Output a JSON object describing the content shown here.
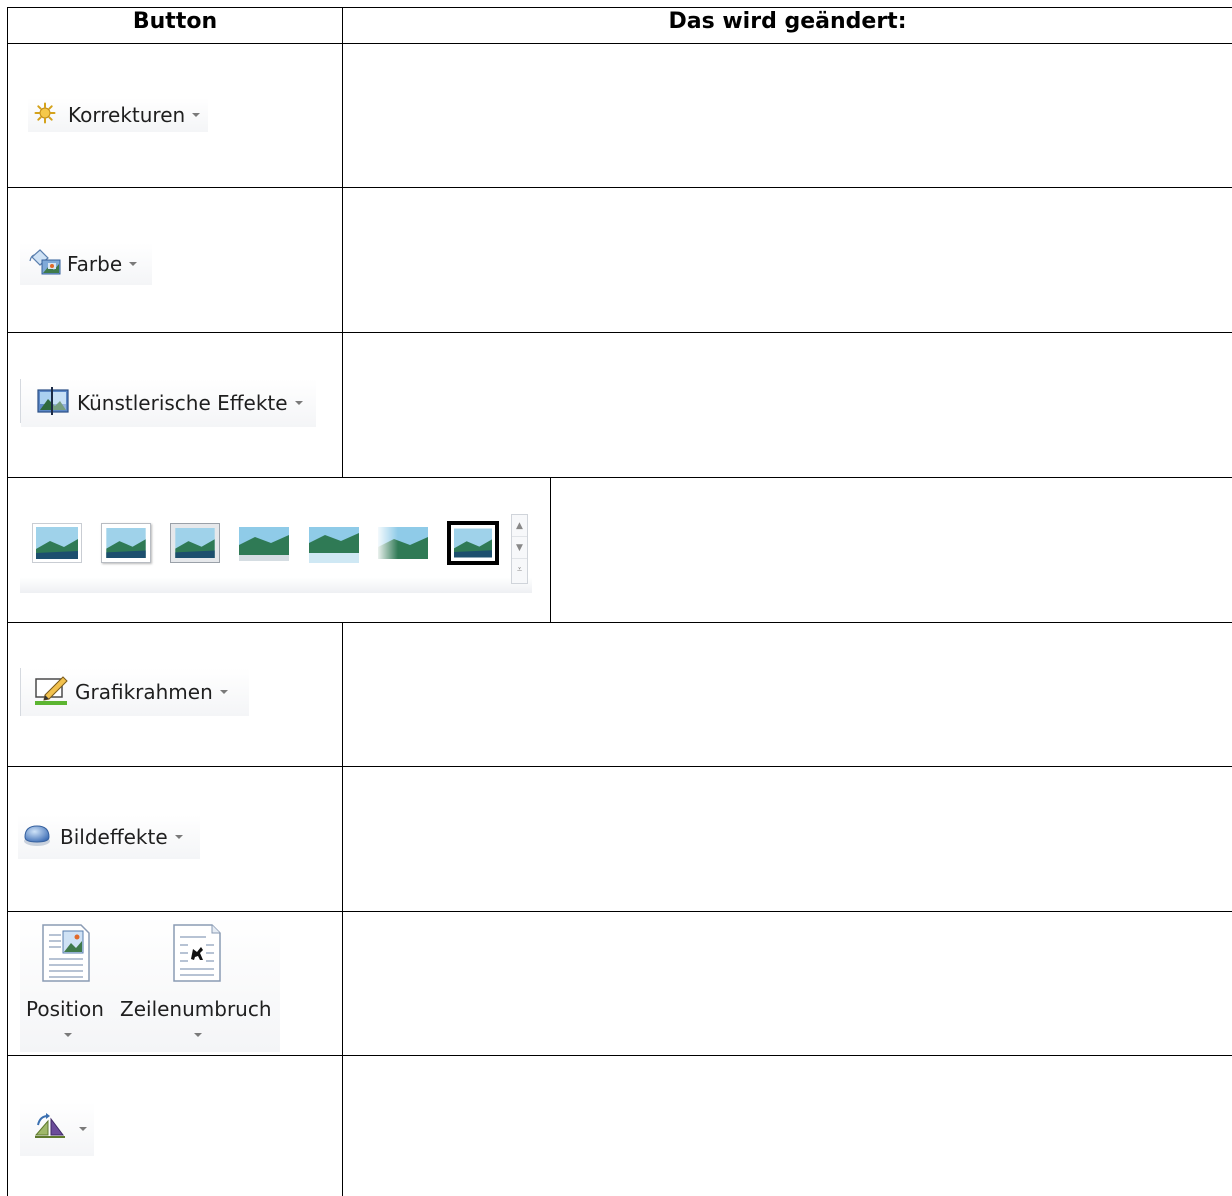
{
  "table": {
    "header_button": "Button",
    "header_changes": "Das wird geändert:"
  },
  "rows": {
    "korrekturen": {
      "label": "Korrekturen",
      "icon": "sun-brightness-icon"
    },
    "farbe": {
      "label": "Farbe",
      "icon": "color-paint-icon"
    },
    "effekte": {
      "label": "Künstlerische Effekte",
      "icon": "artistic-effects-icon"
    },
    "bildformatvorlagen": {
      "icon": "picture-styles-gallery",
      "count": 7
    },
    "grafikrahmen": {
      "label": "Grafikrahmen",
      "icon": "picture-border-pencil-icon"
    },
    "bildeffekte": {
      "label": "Bildeffekte",
      "icon": "picture-effects-icon"
    },
    "position": {
      "label": "Position",
      "icon": "position-page-icon"
    },
    "zeilenumbruch": {
      "label": "Zeilenumbruch",
      "icon": "text-wrap-page-icon"
    },
    "drehen": {
      "icon": "rotate-icon"
    }
  },
  "colors": {
    "border": "#000000",
    "ribbon_text": "#1f1f1f",
    "caret": "#7a7a7a",
    "border_green": "#5cb531"
  }
}
